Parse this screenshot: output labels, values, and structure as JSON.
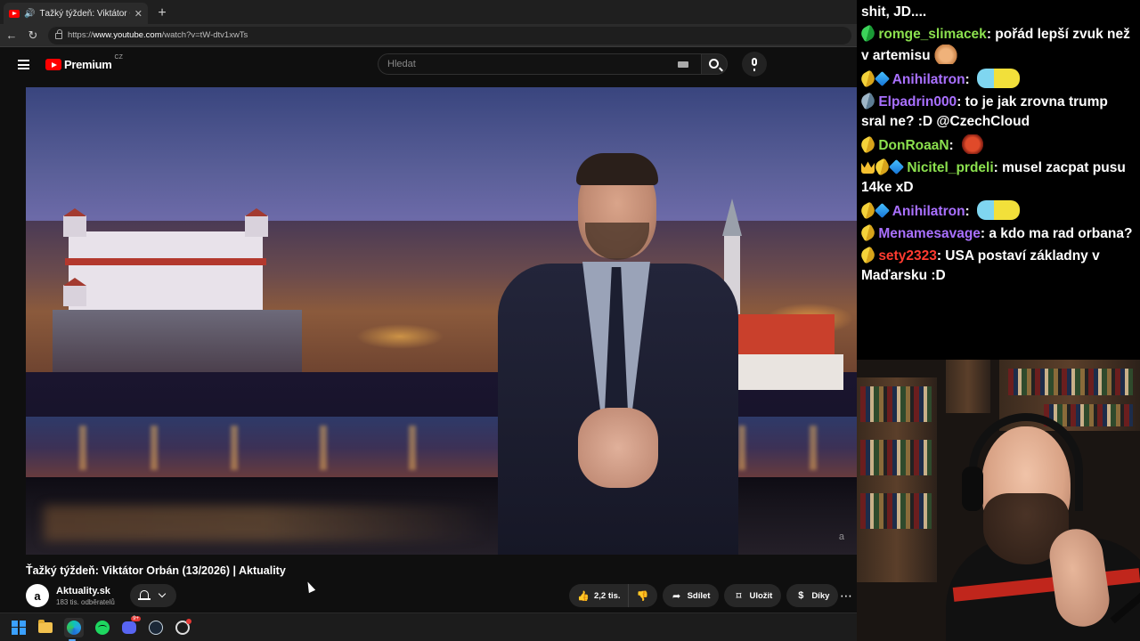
{
  "browser": {
    "tab_title": "Ťažký týždeň: Viktátor Orbán |",
    "url_prefix": "https://",
    "url_host": "www.youtube.com",
    "url_path": "/watch?v=tW-dtv1xwTs"
  },
  "youtube": {
    "logo_text": "Premium",
    "country_code": "CZ",
    "search_placeholder": "Hledat"
  },
  "video": {
    "watermark": "a",
    "title": "Ťažký týždeň: Viktátor Orbán (13/2026) | Aktuality",
    "channel_avatar_letter": "a",
    "channel_name": "Aktuality.sk",
    "channel_subscribers": "183 tis. odběratelů",
    "actions": {
      "like_count": "2,2 tis.",
      "share_label": "Sdílet",
      "save_label": "Uložit",
      "thanks_label": "Díky"
    }
  },
  "taskbar": {
    "discord_badge": "9+"
  },
  "chat": {
    "messages": [
      {
        "user": "",
        "text": "shit, JD....",
        "color": "#ffffff"
      },
      {
        "user": "romge_slimacek",
        "text": "pořád lepší zvuk než v artemisu",
        "color": "#8be04e"
      },
      {
        "user": "Anihilatron",
        "text": "",
        "color": "#a970ff"
      },
      {
        "user": "Elpadrin000",
        "text": "to je jak zrovna trump sral ne? :D @CzechCloud",
        "color": "#a970ff"
      },
      {
        "user": "DonRoaaN",
        "text": "",
        "color": "#8be04e"
      },
      {
        "user": "Nicitel_prdeli",
        "text": "musel zacpat pusu 14ke xD",
        "color": "#8be04e"
      },
      {
        "user": "Anihilatron",
        "text": "",
        "color": "#a970ff"
      },
      {
        "user": "Menamesavage",
        "text": "a kdo ma rad orbana?",
        "color": "#a970ff"
      },
      {
        "user": "sety2323",
        "text": "USA postaví základny v Maďarsku :D",
        "color": "#ff3b30"
      }
    ]
  }
}
